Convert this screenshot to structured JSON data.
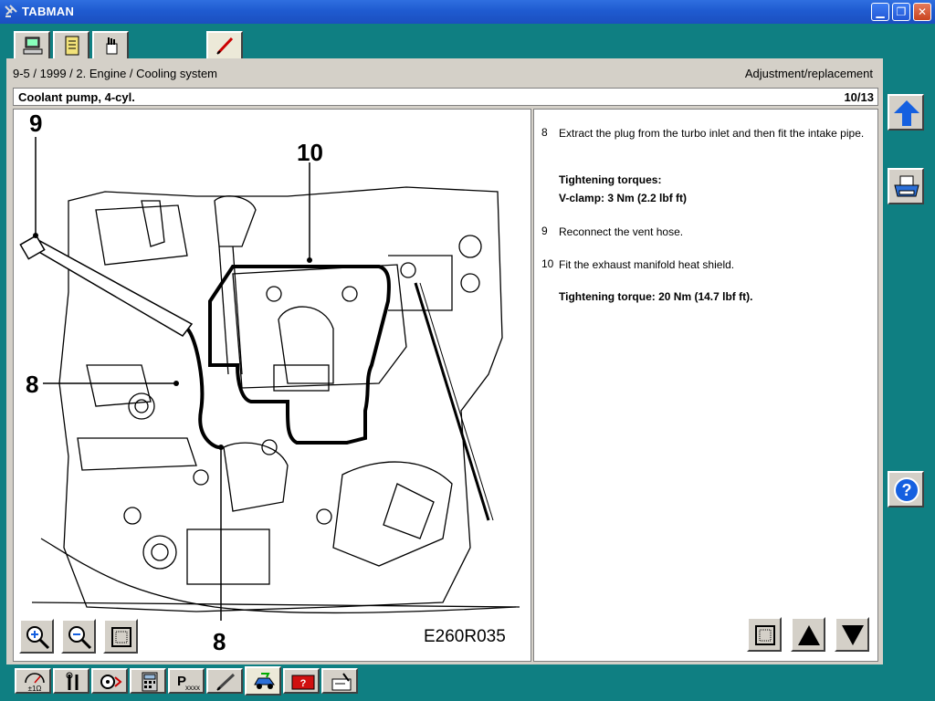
{
  "window": {
    "title": "TABMAN"
  },
  "colors": {
    "background": "#0f7f82",
    "titlebar": "#1f5bd0",
    "panel": "#d4d0c8",
    "arrow_blue": "#1560e0"
  },
  "breadcrumb": "9-5 / 1999 / 2. Engine / Cooling system",
  "mode": "Adjustment/replacement",
  "document": {
    "title": "Coolant pump, 4-cyl.",
    "page": "10/13"
  },
  "diagram": {
    "code": "E260R035",
    "callouts": [
      "9",
      "10",
      "8",
      "8"
    ]
  },
  "steps": [
    {
      "num": "8",
      "text": "Extract the plug from the turbo inlet and then fit the intake pipe."
    },
    {
      "num": "9",
      "text": "Reconnect the vent hose."
    },
    {
      "num": "10",
      "text": "Fit the exhaust manifold heat shield."
    }
  ],
  "torque_blocks": {
    "heading": "Tightening torques:",
    "vclamp": "V-clamp: 3 Nm (2.2 lbf ft)",
    "heat_shield": "Tightening torque: 20 Nm (14.7 lbf ft)."
  },
  "top_tabs": [
    "computer-icon",
    "document-icon",
    "hand-icon",
    "pen-icon"
  ],
  "bottom_tabs": [
    "multimeter-icon",
    "wrench-icon",
    "gauge-icon",
    "calculator-icon",
    "part-number-icon",
    "pen-icon",
    "car-service-icon",
    "warning-card-icon",
    "clipboard-icon"
  ],
  "bottom_labels": {
    "ohm": "±1Ω",
    "parts": "xxxx"
  }
}
